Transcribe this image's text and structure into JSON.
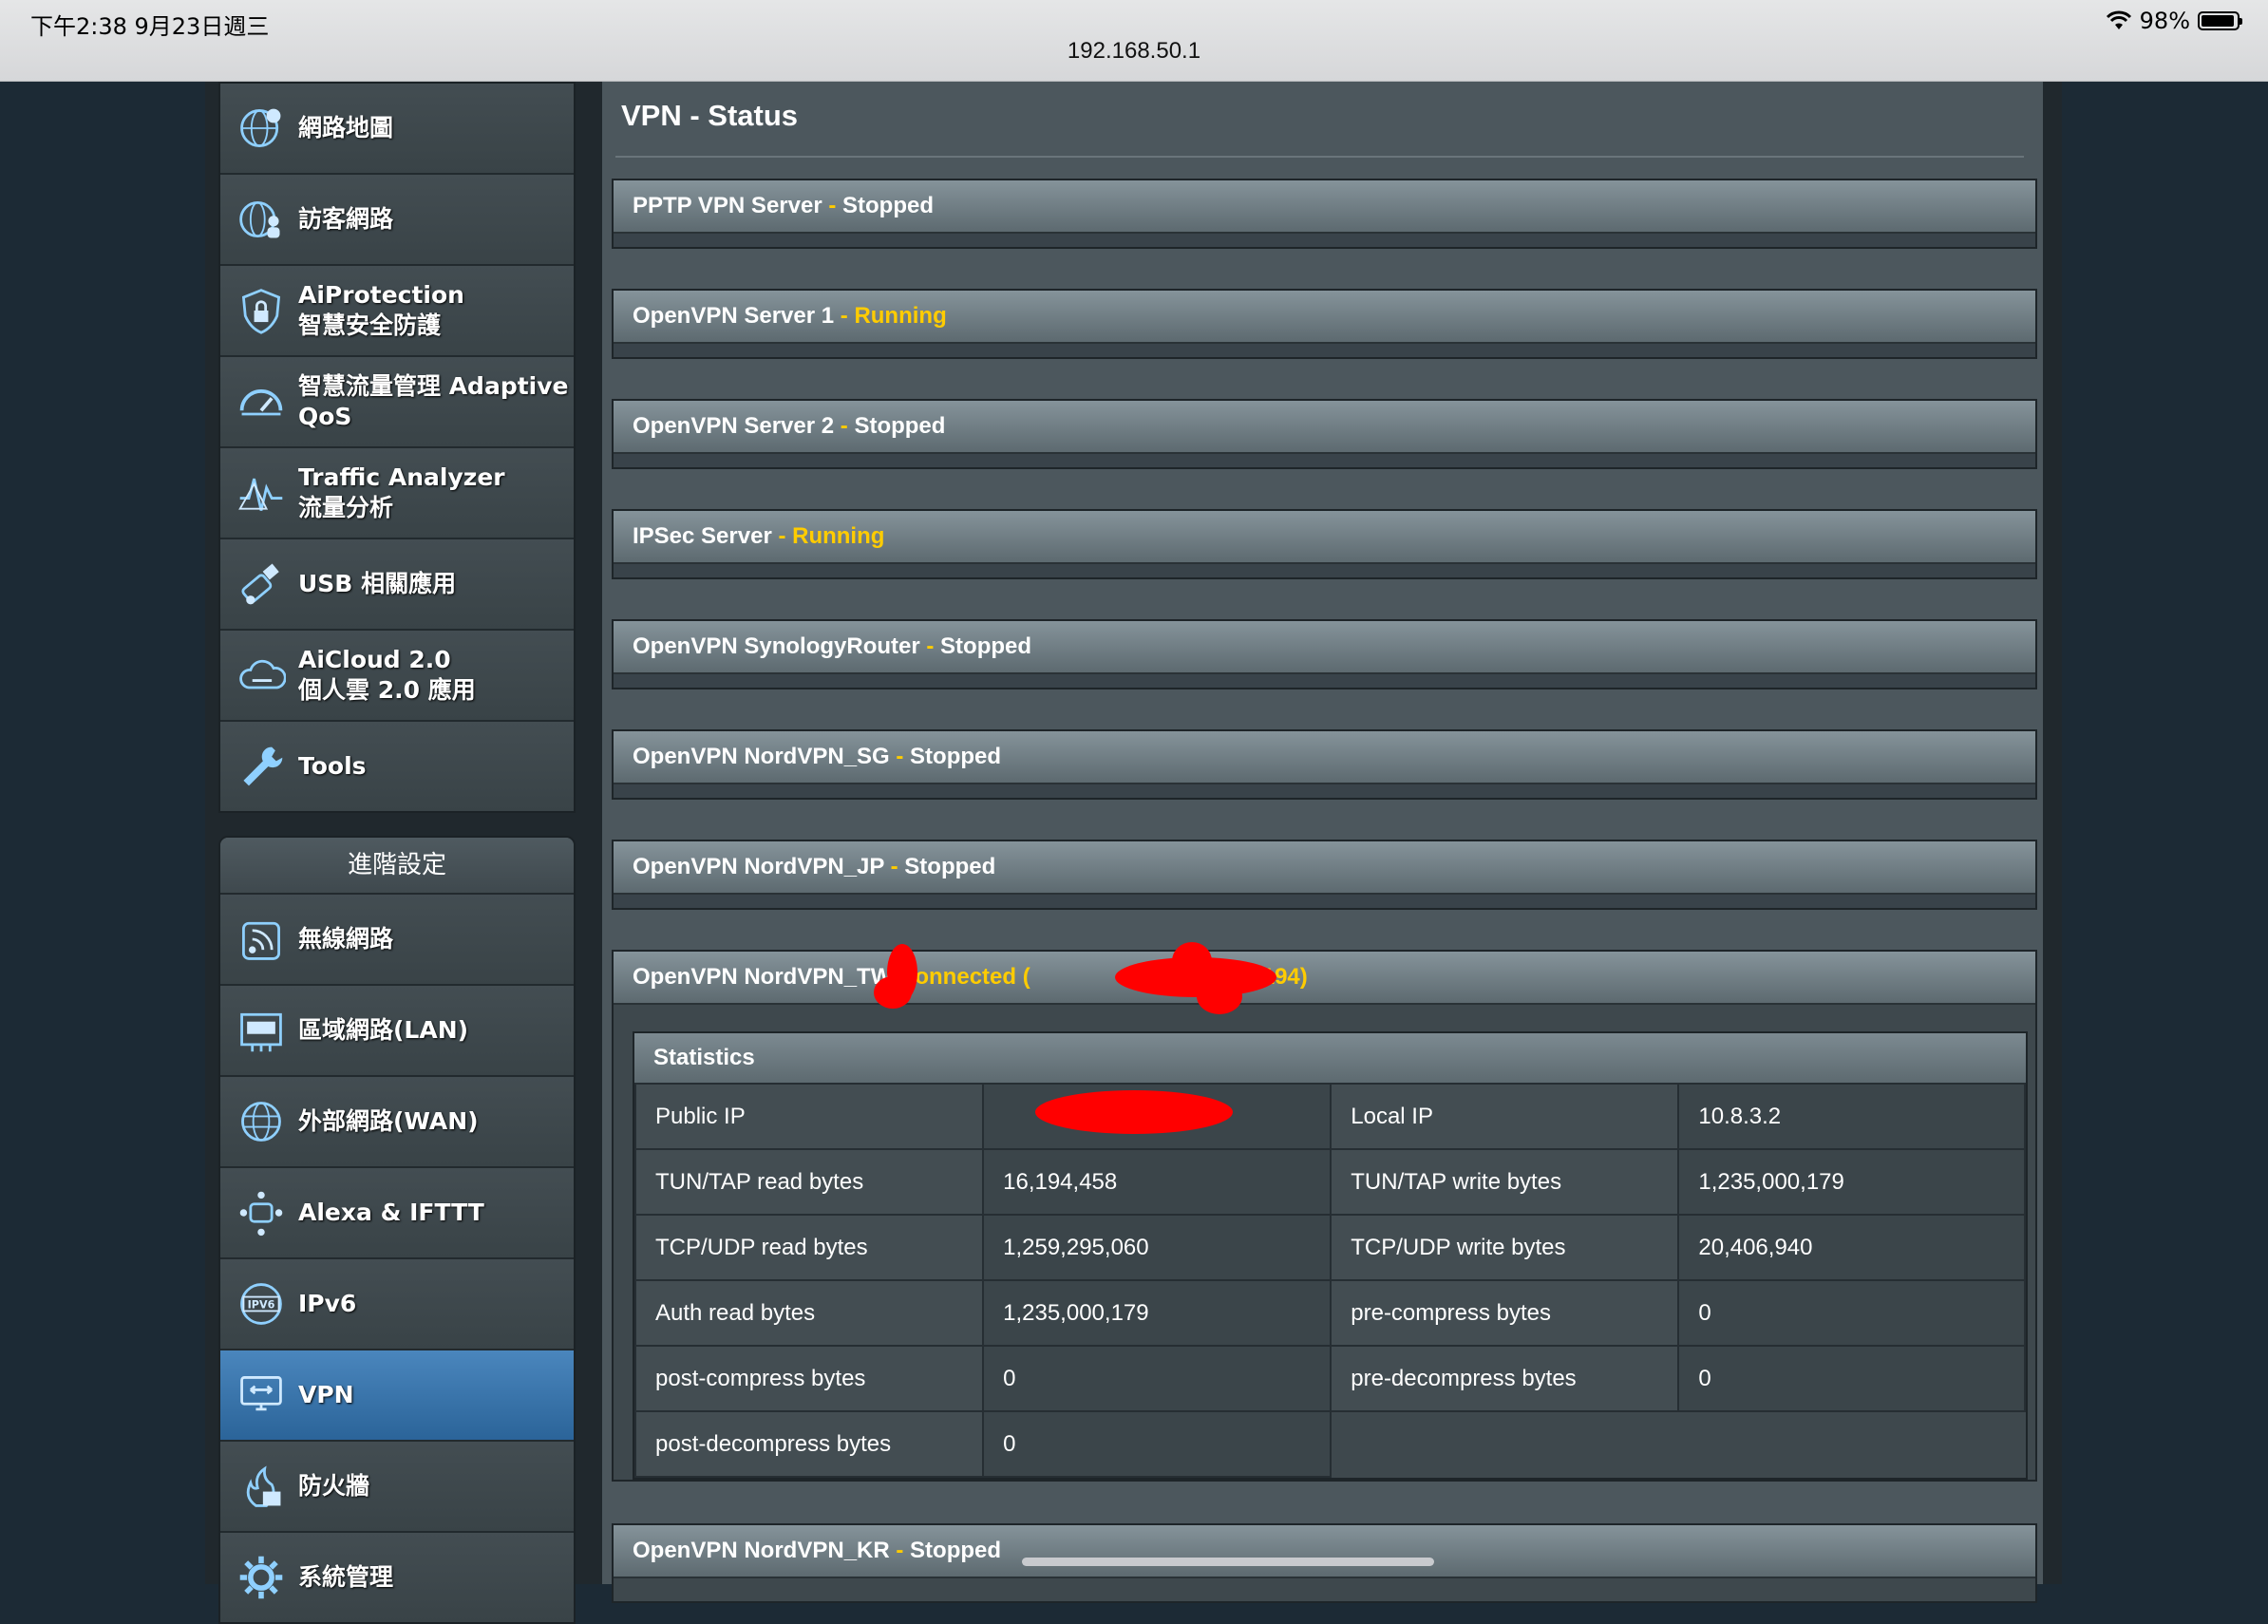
{
  "status_bar": {
    "time": "下午2:38   9月23日週三",
    "battery": "98%",
    "url": "192.168.50.1"
  },
  "sidebar": {
    "general_items": [
      {
        "label": "網路地圖",
        "icon": "globe-map-icon"
      },
      {
        "label": "訪客網路",
        "icon": "guest-network-icon"
      },
      {
        "label": "AiProtection\n智慧安全防護",
        "icon": "shield-lock-icon"
      },
      {
        "label": "智慧流量管理 Adaptive QoS",
        "icon": "speedometer-icon"
      },
      {
        "label": "Traffic Analyzer\n流量分析",
        "icon": "traffic-wave-icon"
      },
      {
        "label": "USB 相關應用",
        "icon": "usb-icon"
      },
      {
        "label": "AiCloud 2.0\n個人雲 2.0 應用",
        "icon": "cloud-icon"
      },
      {
        "label": "Tools",
        "icon": "wrench-icon"
      }
    ],
    "advanced_header": "進階設定",
    "advanced_items": [
      {
        "label": "無線網路",
        "icon": "wireless-icon"
      },
      {
        "label": "區域網路(LAN)",
        "icon": "lan-icon"
      },
      {
        "label": "外部網路(WAN)",
        "icon": "wan-globe-icon"
      },
      {
        "label": "Alexa & IFTTT",
        "icon": "alexa-icon"
      },
      {
        "label": "IPv6",
        "icon": "ipv6-icon"
      },
      {
        "label": "VPN",
        "icon": "vpn-monitor-icon",
        "active": true
      },
      {
        "label": "防火牆",
        "icon": "firewall-icon"
      },
      {
        "label": "系統管理",
        "icon": "gear-icon"
      }
    ]
  },
  "main": {
    "title": "VPN - Status",
    "blocks": [
      {
        "name": "PPTP VPN Server",
        "sep": " - ",
        "status": "Stopped",
        "running": false
      },
      {
        "name": "OpenVPN Server 1",
        "sep": " - ",
        "status": "Running",
        "running": true
      },
      {
        "name": "OpenVPN Server 2",
        "sep": " - ",
        "status": "Stopped",
        "running": false
      },
      {
        "name": "IPSec Server",
        "sep": " - ",
        "status": "Running",
        "running": true
      },
      {
        "name": "OpenVPN SynologyRouter",
        "sep": " - ",
        "status": "Stopped",
        "running": false
      },
      {
        "name": "OpenVPN NordVPN_SG",
        "sep": " - ",
        "status": "Stopped",
        "running": false
      },
      {
        "name": "OpenVPN NordVPN_JP",
        "sep": " - ",
        "status": "Stopped",
        "running": false
      }
    ],
    "connected_block": {
      "name": "OpenVPN NordVPN_TW",
      "status_prefix": " Connected (",
      "status_suffix": "3 udp:1194)",
      "stats_title": "Statistics",
      "rows": [
        [
          {
            "k": "Public IP",
            "v": ""
          },
          {
            "k": "Local IP",
            "v": "10.8.3.2"
          }
        ],
        [
          {
            "k": "TUN/TAP read bytes",
            "v": "16,194,458"
          },
          {
            "k": "TUN/TAP write bytes",
            "v": "1,235,000,179"
          }
        ],
        [
          {
            "k": "TCP/UDP read bytes",
            "v": "1,259,295,060"
          },
          {
            "k": "TCP/UDP write bytes",
            "v": "20,406,940"
          }
        ],
        [
          {
            "k": "Auth read bytes",
            "v": "1,235,000,179"
          },
          {
            "k": "pre-compress bytes",
            "v": "0"
          }
        ],
        [
          {
            "k": "post-compress bytes",
            "v": "0"
          },
          {
            "k": "pre-decompress bytes",
            "v": "0"
          }
        ],
        [
          {
            "k": "post-decompress bytes",
            "v": "0"
          }
        ]
      ]
    },
    "last_block": {
      "name": "OpenVPN NordVPN_KR",
      "sep": " - ",
      "status": "Stopped"
    }
  }
}
